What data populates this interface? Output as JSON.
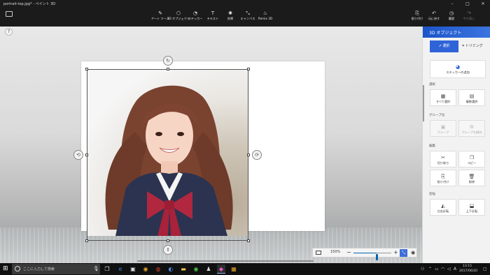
{
  "window": {
    "title": "portrait-top.jpg* - ペイント 3D"
  },
  "toolbar": {
    "tools": [
      {
        "label": "アート ツール",
        "icon": "brush-icon"
      },
      {
        "label": "3D オブジェクト",
        "icon": "cube-icon"
      },
      {
        "label": "ステッカー",
        "icon": "sticker-icon"
      },
      {
        "label": "テキスト",
        "icon": "text-icon"
      },
      {
        "label": "効果",
        "icon": "effects-icon"
      },
      {
        "label": "キャンバス",
        "icon": "canvas-icon"
      },
      {
        "label": "Remix 3D",
        "icon": "remix-icon"
      }
    ],
    "actions": [
      {
        "label": "貼り付け",
        "icon": "paste-icon"
      },
      {
        "label": "元に戻す",
        "icon": "undo-icon"
      },
      {
        "label": "履歴",
        "icon": "history-icon"
      },
      {
        "label": "やり直し",
        "icon": "redo-icon"
      }
    ]
  },
  "canvas": {
    "zoom": "150%",
    "zoom_level": 0.62
  },
  "panel": {
    "title": "3D オブジェクト",
    "mode_select": "選択",
    "mode_trim": "トリミング",
    "add_sticker": "ステッカーの追加",
    "section_select": "選択",
    "select_all": "すべて選択",
    "select_multi": "複数選択",
    "section_group": "グループ化",
    "group": "グループ",
    "ungroup": "グループを解除",
    "section_edit": "編集",
    "cut": "切り取り",
    "copy": "コピー",
    "paste": "貼り付け",
    "delete": "削除",
    "section_flip": "反転",
    "flip_h": "左右反転",
    "flip_v": "上下反転"
  },
  "taskbar": {
    "search_placeholder": "ここに入力して検索",
    "time": "13:15",
    "date": "2017/06/20"
  },
  "colors": {
    "accent": "#2f63d8",
    "panel_header": "#1b54c9",
    "titlebar": "#1b1b1b",
    "taskbar": "#101010"
  }
}
